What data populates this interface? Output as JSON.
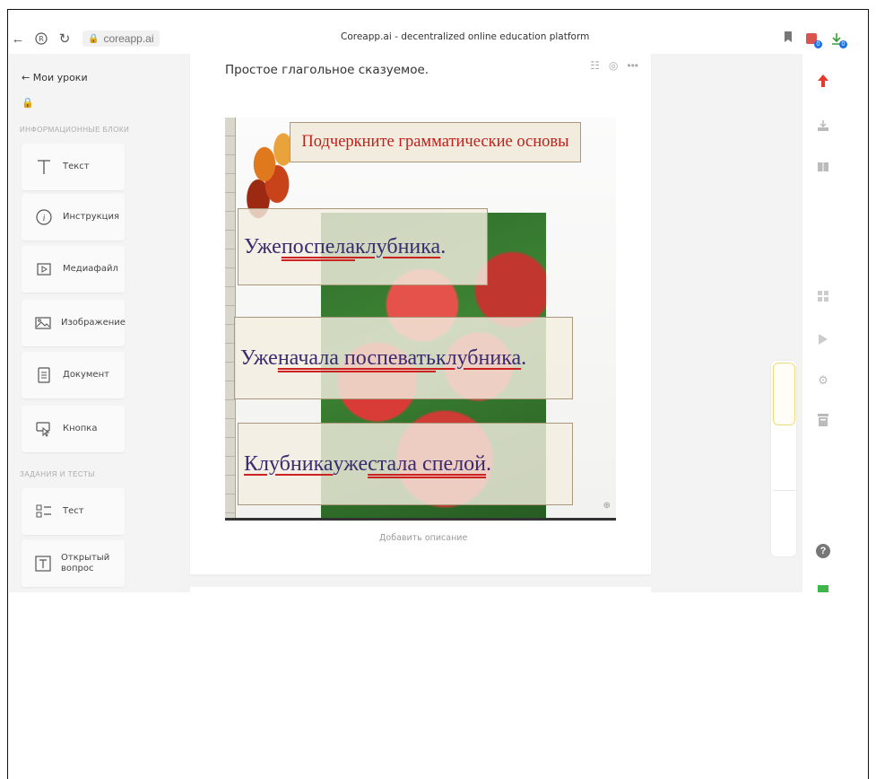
{
  "browser": {
    "url": "coreapp.ai",
    "page_title": "Coreapp.ai - decentralized online education platform",
    "extension_badge": "0"
  },
  "sidebar": {
    "back_label": "Мои уроки",
    "section_info": "ИНФОРМАЦИОННЫЕ БЛОКИ",
    "section_tasks": "ЗАДАНИЯ И ТЕСТЫ",
    "info_blocks": [
      {
        "label": "Текст",
        "icon": "text-icon"
      },
      {
        "label": "Инструкция",
        "icon": "info-icon"
      },
      {
        "label": "Медиафайл",
        "icon": "media-icon"
      },
      {
        "label": "Изображение",
        "icon": "image-icon"
      },
      {
        "label": "Документ",
        "icon": "document-icon"
      },
      {
        "label": "Кнопка",
        "icon": "button-icon"
      }
    ],
    "task_blocks": [
      {
        "label": "Тест",
        "icon": "test-icon"
      },
      {
        "label": "Открытый вопрос",
        "icon": "open-question-icon"
      }
    ]
  },
  "card": {
    "title": "Простое глагольное сказуемое.",
    "add_description": "Добавить описание"
  },
  "slide": {
    "heading": "Подчеркните грамматические основы",
    "sentence1": {
      "pre": "Уже ",
      "predicate": "поспела",
      "mid": " ",
      "subject": "клубника",
      "post": "."
    },
    "sentence2": {
      "pre": "Уже ",
      "predicate": "начала поспевать",
      "mid": " ",
      "subject": "клубника",
      "post": "."
    },
    "sentence3": {
      "subject": "Клубника",
      "mid": " уже ",
      "predicate": "стала спелой",
      "post": "."
    }
  },
  "colors": {
    "accent_red": "#e8392f",
    "heading_red": "#c0201b",
    "sentence_text": "#3a2a6e",
    "underline_red": "#cc2222",
    "scroll_thumb_border": "#f1dd75"
  }
}
